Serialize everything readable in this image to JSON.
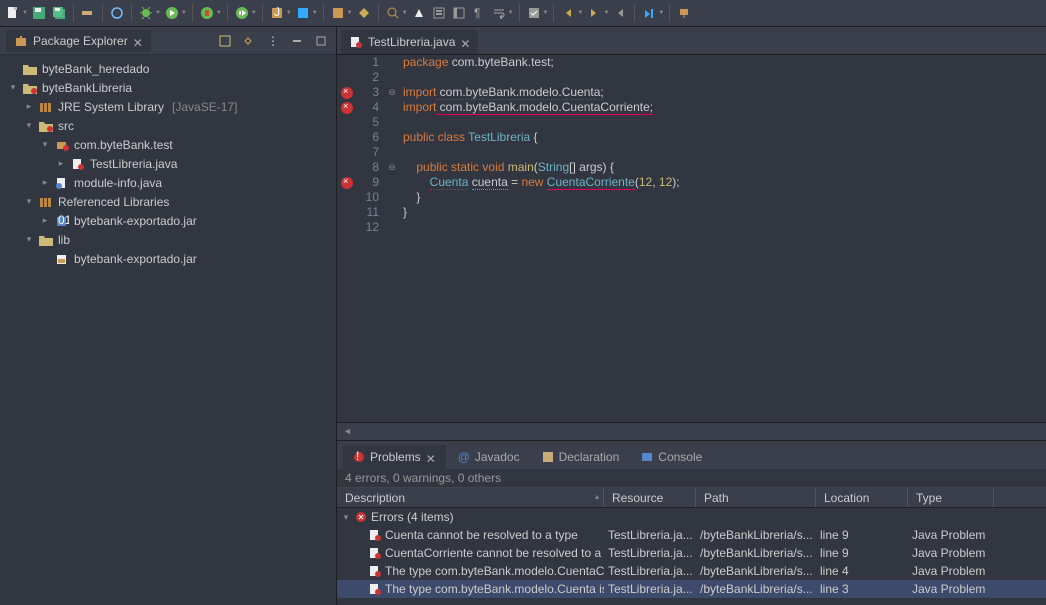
{
  "explorer": {
    "title": "Package Explorer",
    "tree": {
      "proj1": "byteBank_heredado",
      "proj2": "byteBankLibreria",
      "jre": "JRE System Library",
      "jre_ver": "[JavaSE-17]",
      "src": "src",
      "pkg": "com.byteBank.test",
      "file1": "TestLibreria.java",
      "file2": "module-info.java",
      "reflib": "Referenced Libraries",
      "jar1": "bytebank-exportado.jar",
      "lib": "lib",
      "jar2": "bytebank-exportado.jar"
    }
  },
  "editor": {
    "tab": "TestLibreria.java",
    "lines": {
      "l1a": "package",
      "l1b": " com.byteBank.test;",
      "l3a": "import",
      "l3b": " com.byteBank.modelo.Cuenta;",
      "l4a": "import",
      "l4b": " com.byteBank.modelo.CuentaCorriente;",
      "l6a": "public",
      "l6b": "class",
      "l6c": "TestLibreria",
      "l6d": " {",
      "l8a": "public",
      "l8b": "static",
      "l8c": "void",
      "l8d": "main",
      "l8e": "(",
      "l8f": "String",
      "l8g": "[] args) {",
      "l9a": "Cuenta",
      "l9b": "cuenta",
      "l9c": " = ",
      "l9d": "new",
      "l9e": "CuentaCorriente",
      "l9f": "(",
      "l9g": "12",
      "l9h": ", ",
      "l9i": "12",
      "l9j": ");",
      "l10": "    }",
      "l11": "}"
    }
  },
  "problems": {
    "tabs": {
      "problems": "Problems",
      "javadoc": "Javadoc",
      "declaration": "Declaration",
      "console": "Console"
    },
    "summary": "4 errors, 0 warnings, 0 others",
    "cols": {
      "desc": "Description",
      "res": "Resource",
      "path": "Path",
      "loc": "Location",
      "type": "Type"
    },
    "group": "Errors (4 items)",
    "items": [
      {
        "desc": "Cuenta cannot be resolved to a type",
        "res": "TestLibreria.ja...",
        "path": "/byteBankLibreria/s...",
        "loc": "line 9",
        "type": "Java Problem"
      },
      {
        "desc": "CuentaCorriente cannot be resolved to a type",
        "res": "TestLibreria.ja...",
        "path": "/byteBankLibreria/s...",
        "loc": "line 9",
        "type": "Java Problem"
      },
      {
        "desc": "The type com.byteBank.modelo.CuentaCorrier",
        "res": "TestLibreria.ja...",
        "path": "/byteBankLibreria/s...",
        "loc": "line 4",
        "type": "Java Problem"
      },
      {
        "desc": "The type com.byteBank.modelo.Cuenta is not",
        "res": "TestLibreria.ja...",
        "path": "/byteBankLibreria/s...",
        "loc": "line 3",
        "type": "Java Problem"
      }
    ]
  }
}
